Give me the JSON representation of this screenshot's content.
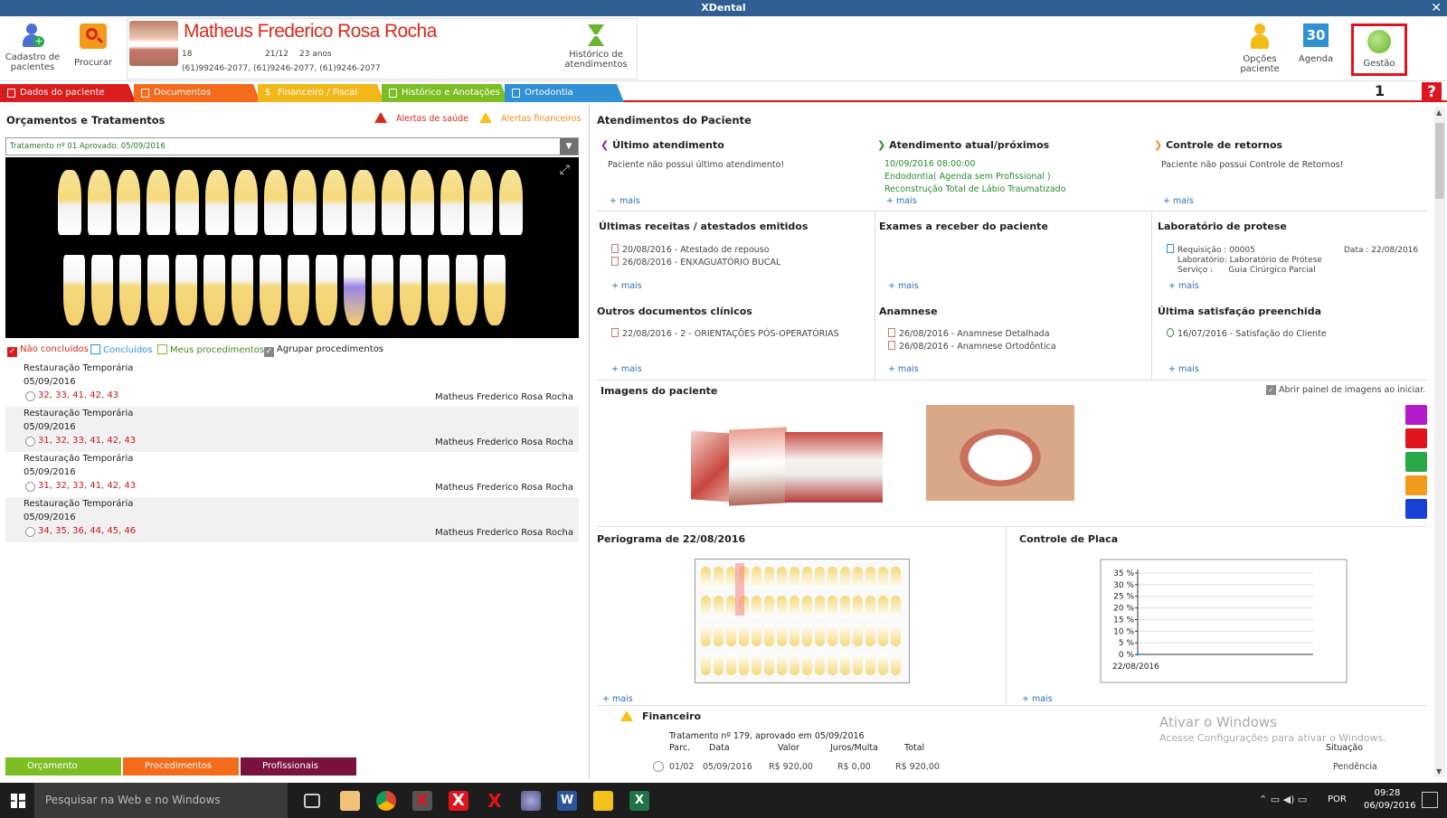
{
  "app": {
    "title": "XDental"
  },
  "toolbar": {
    "cadastro": "Cadastro de pacientes",
    "procurar": "Procurar",
    "historico": "Histórico de atendimentos",
    "opcoes": "Opções paciente",
    "agenda": "Agenda",
    "agenda_day": "30",
    "gestao": "Gestão"
  },
  "patient": {
    "name": "Matheus Frederico Rosa Rocha",
    "age_num": "18",
    "birthday": "21/12",
    "age": "23 anos",
    "phones": "(61)99246-2077, (61)9246-2077, (61)9246-2077"
  },
  "tabs": [
    {
      "label": "Dados do paciente",
      "color": "#d91c1c"
    },
    {
      "label": "Documentos",
      "color": "#f46b1b"
    },
    {
      "label": "Financeiro / Fiscal",
      "color": "#f2b81a"
    },
    {
      "label": "Histórico e Anotações",
      "color": "#7cbe24"
    },
    {
      "label": "Ortodontia",
      "color": "#2f90d6"
    }
  ],
  "annotation_number": "1",
  "help": "?",
  "left": {
    "title": "Orçamentos e Tratamentos",
    "alert_health": "Alertas de saúde",
    "alert_fin": "Alertas financeiros",
    "treatment_select": "Tratamento nº 01 Aprovado. 05/09/2016",
    "filters": {
      "nao_concluidos": "Não concluídos",
      "concluidos": "Concluídos",
      "meus": "Meus procedimentos",
      "agrupar": "Agrupar procedimentos"
    },
    "procedures": [
      {
        "name": "Restauração Temporária",
        "date": "05/09/2016",
        "teeth": "32, 33, 41, 42, 43",
        "who": "Matheus Frederico Rosa Rocha"
      },
      {
        "name": "Restauração Temporária",
        "date": "05/09/2016",
        "teeth": "31, 32, 33, 41, 42, 43",
        "who": "Matheus Frederico Rosa Rocha"
      },
      {
        "name": "Restauração Temporária",
        "date": "05/09/2016",
        "teeth": "31, 32, 33, 41, 42, 43",
        "who": "Matheus Frederico Rosa Rocha"
      },
      {
        "name": "Restauração Temporária",
        "date": "05/09/2016",
        "teeth": "34, 35, 36, 44, 45, 46",
        "who": "Matheus Frederico Rosa Rocha"
      }
    ],
    "bottom_tabs": [
      {
        "label": "Orçamento",
        "color": "#7cbe24"
      },
      {
        "label": "Procedimentos",
        "color": "#f46b1b"
      },
      {
        "label": "Profissionais",
        "color": "#7a1240"
      }
    ]
  },
  "right": {
    "title": "Atendimentos do Paciente",
    "mais": "+ mais",
    "ultimo": {
      "title": "Último atendimento",
      "text": "Paciente não possui último atendimento!"
    },
    "atual": {
      "title": "Atendimento atual/próximos",
      "lines": [
        "10/09/2016 08:00:00",
        "Endodontia( Agenda sem Profissional )",
        "Reconstrução Total de Lábio Traumatizado"
      ]
    },
    "retornos": {
      "title": "Controle de retornos",
      "text": "Paciente não possui Controle de Retornos!"
    },
    "receitas": {
      "title": "Últimas receitas / atestados emitidos",
      "items": [
        "20/08/2016 - Atestado de repouso",
        "26/08/2016 - ENXAGUATÓRIO BUCAL"
      ]
    },
    "exames": {
      "title": "Exames a receber do paciente"
    },
    "laboratorio": {
      "title": "Laboratório de protese",
      "req": "Requisição : 00005",
      "data": "Data : 22/08/2016",
      "lab": "Laboratório: Laboratório de Prótese",
      "serv": "Serviço :      Guia Cirúrgico Parcial"
    },
    "outros": {
      "title": "Outros documentos clínicos",
      "items": [
        "22/08/2016 -  2 - ORIENTAÇÕES PÓS-OPERATÓRIAS"
      ]
    },
    "anamnese": {
      "title": "Anamnese",
      "items": [
        "26/08/2016 - Anamnese Detalhada",
        "26/08/2016 - Anamnese Ortodôntica"
      ]
    },
    "satisfacao": {
      "title": "Última satisfação preenchida",
      "items": [
        "16/07/2016 - Satisfação do Cliente"
      ]
    },
    "imagens": {
      "title": "Imagens do paciente",
      "abrir": "Abrir painel de imagens ao iniciar."
    },
    "periograma": {
      "title": "Periograma de 22/08/2016"
    },
    "placa": {
      "title": "Controle de Placa"
    },
    "financeiro": {
      "title": "Financeiro",
      "tratamento": "Tratamento nº 179, aprovado em 05/09/2016",
      "headers": [
        "Parc.",
        "Data",
        "Valor",
        "Juros/Multa",
        "Total"
      ],
      "row": [
        "01/02",
        "05/09/2016",
        "R$ 920,00",
        "R$ 0,00",
        "R$ 920,00"
      ],
      "situacao_header": "Situação",
      "situacao": "Pendência"
    },
    "watermark1": "Ativar o Windows",
    "watermark2": "Acesse Configurações para ativar o Windows."
  },
  "chart_data": {
    "type": "line",
    "title": "",
    "x": [
      "22/08/2016"
    ],
    "yticks": [
      "35 %",
      "30 %",
      "25 %",
      "20 %",
      "15 %",
      "10 %",
      "5 %",
      "0 %"
    ],
    "ylim": [
      0,
      35
    ],
    "series": [
      {
        "values": [
          0
        ]
      }
    ]
  },
  "taskbar": {
    "search": "Pesquisar na Web e no Windows",
    "lang": "POR",
    "time": "09:28",
    "date": "06/09/2016"
  }
}
